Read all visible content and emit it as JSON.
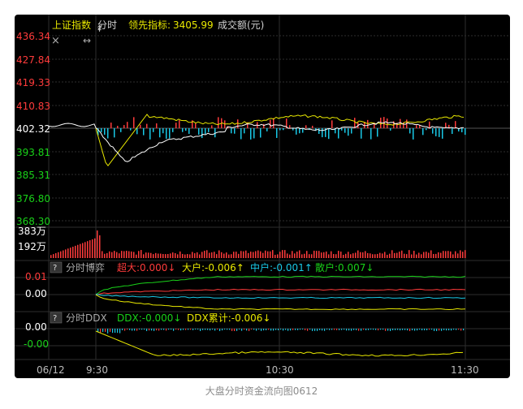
{
  "header": {
    "index_name": "上证指数",
    "mode": "分时",
    "leading_label": "领先指标:",
    "leading_value": "3405.99",
    "volume_label": "成交额(元)"
  },
  "price_axis": {
    "labels": [
      "436.34",
      "427.84",
      "419.33",
      "410.83",
      "402.32",
      "393.81",
      "385.31",
      "376.80",
      "368.30"
    ],
    "colors": [
      "#ff3b3b",
      "#ff3b3b",
      "#ff3b3b",
      "#ff3b3b",
      "#ffffff",
      "#19d219",
      "#19d219",
      "#19d219",
      "#19d219"
    ]
  },
  "volume_axis": {
    "labels": [
      "383万",
      "192万"
    ]
  },
  "boyi_panel": {
    "help": "?",
    "title": "分时博弈",
    "items": [
      {
        "label": "超大:0.000",
        "arrow": "↓",
        "color": "#ff3b3b"
      },
      {
        "label": "大户:-0.006",
        "arrow": "↑",
        "color": "#e8e800"
      },
      {
        "label": "中户:-0.001",
        "arrow": "↑",
        "color": "#19c8e6"
      },
      {
        "label": "散户:0.007",
        "arrow": "↓",
        "color": "#19d219"
      }
    ],
    "axis": [
      "0.01",
      "0.00"
    ]
  },
  "ddx_panel": {
    "help": "?",
    "title": "分时DDX",
    "items": [
      {
        "label": "DDX:-0.000",
        "arrow": "↓",
        "color": "#19d219"
      },
      {
        "label": "DDX累计:-0.006",
        "arrow": "↓",
        "color": "#e8e800"
      }
    ],
    "axis": [
      "0.00",
      "-0.00"
    ]
  },
  "time_axis": [
    "06/12",
    "9:30",
    "10:30",
    "11:30"
  ],
  "toolbar": {
    "close": "×",
    "resize": "↔",
    "pin": "⇞"
  },
  "watermark": "…",
  "caption": "大盘分时资金流向图0612",
  "colors": {
    "background": "#000000",
    "grid": "#2e2e2e",
    "up": "#ff3b3b",
    "down": "#19d219",
    "index_line": "#ffffff",
    "avg_line": "#e8e800",
    "ddx_bar": "#19c8e6",
    "axis_text": "#ffffff",
    "title_text": "#e8e800"
  }
}
